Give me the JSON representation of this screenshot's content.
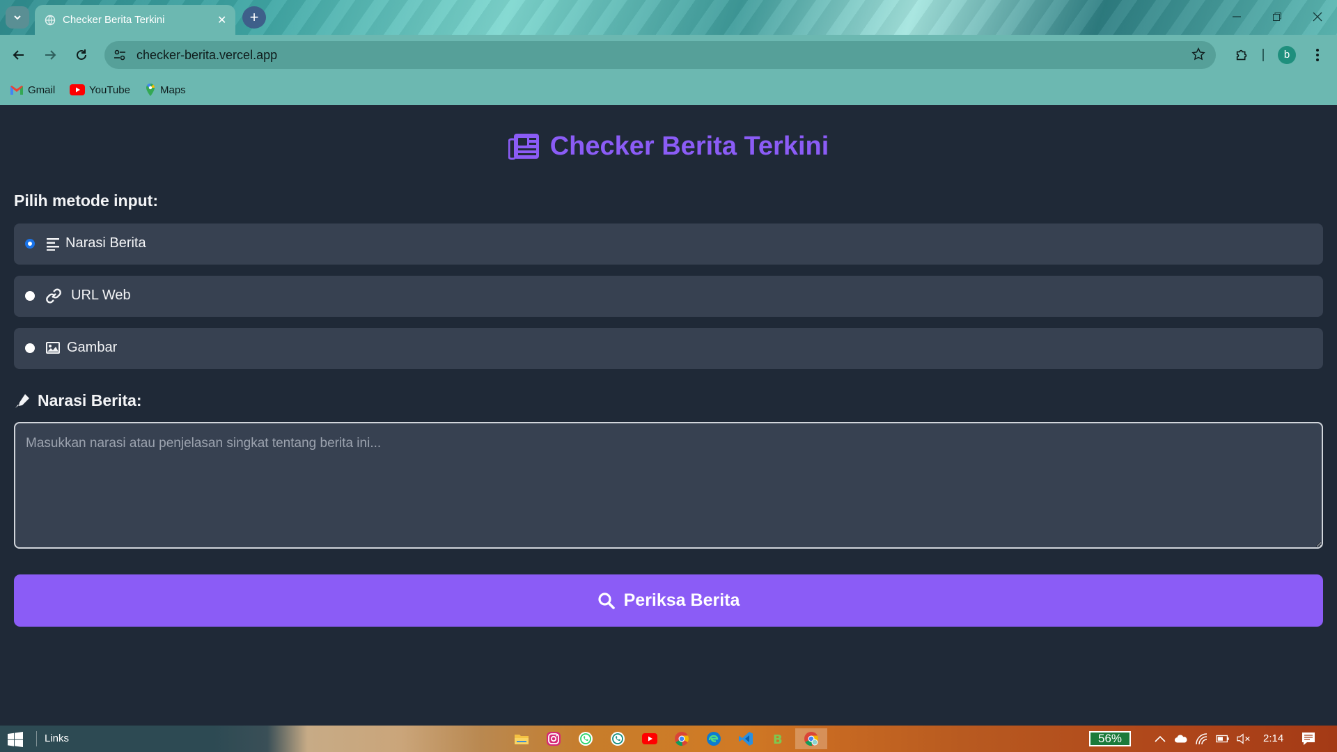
{
  "browser": {
    "tab_title": "Checker Berita Terkini",
    "url": "checker-berita.vercel.app",
    "profile_initial": "b",
    "bookmarks": [
      {
        "label": "Gmail",
        "icon": "gmail-icon"
      },
      {
        "label": "YouTube",
        "icon": "youtube-icon"
      },
      {
        "label": "Maps",
        "icon": "maps-icon"
      }
    ]
  },
  "app": {
    "title": "Checker Berita Terkini",
    "title_icon": "newspaper-icon",
    "accent_color": "#8b5cf6",
    "background_color": "#1f2937",
    "input_method_label": "Pilih metode input:",
    "options": [
      {
        "label": "Narasi Berita",
        "icon": "align-left-icon",
        "selected": true
      },
      {
        "label": "URL Web",
        "icon": "link-icon",
        "selected": false
      },
      {
        "label": "Gambar",
        "icon": "image-icon",
        "selected": false
      }
    ],
    "field_label": "Narasi Berita:",
    "field_icon": "pen-icon",
    "textarea_placeholder": "Masukkan narasi atau penjelasan singkat tentang berita ini...",
    "textarea_value": "",
    "submit_label": "Periksa Berita",
    "submit_icon": "search-icon"
  },
  "taskbar": {
    "links_label": "Links",
    "battery": "56%",
    "time": "2:14",
    "apps": [
      "file-explorer-icon",
      "instagram-icon",
      "whatsapp-icon",
      "whatsapp-business-icon",
      "youtube-icon",
      "chrome-icon",
      "edge-icon",
      "vscode-icon",
      "app-b-icon",
      "chrome-profile-icon"
    ]
  }
}
